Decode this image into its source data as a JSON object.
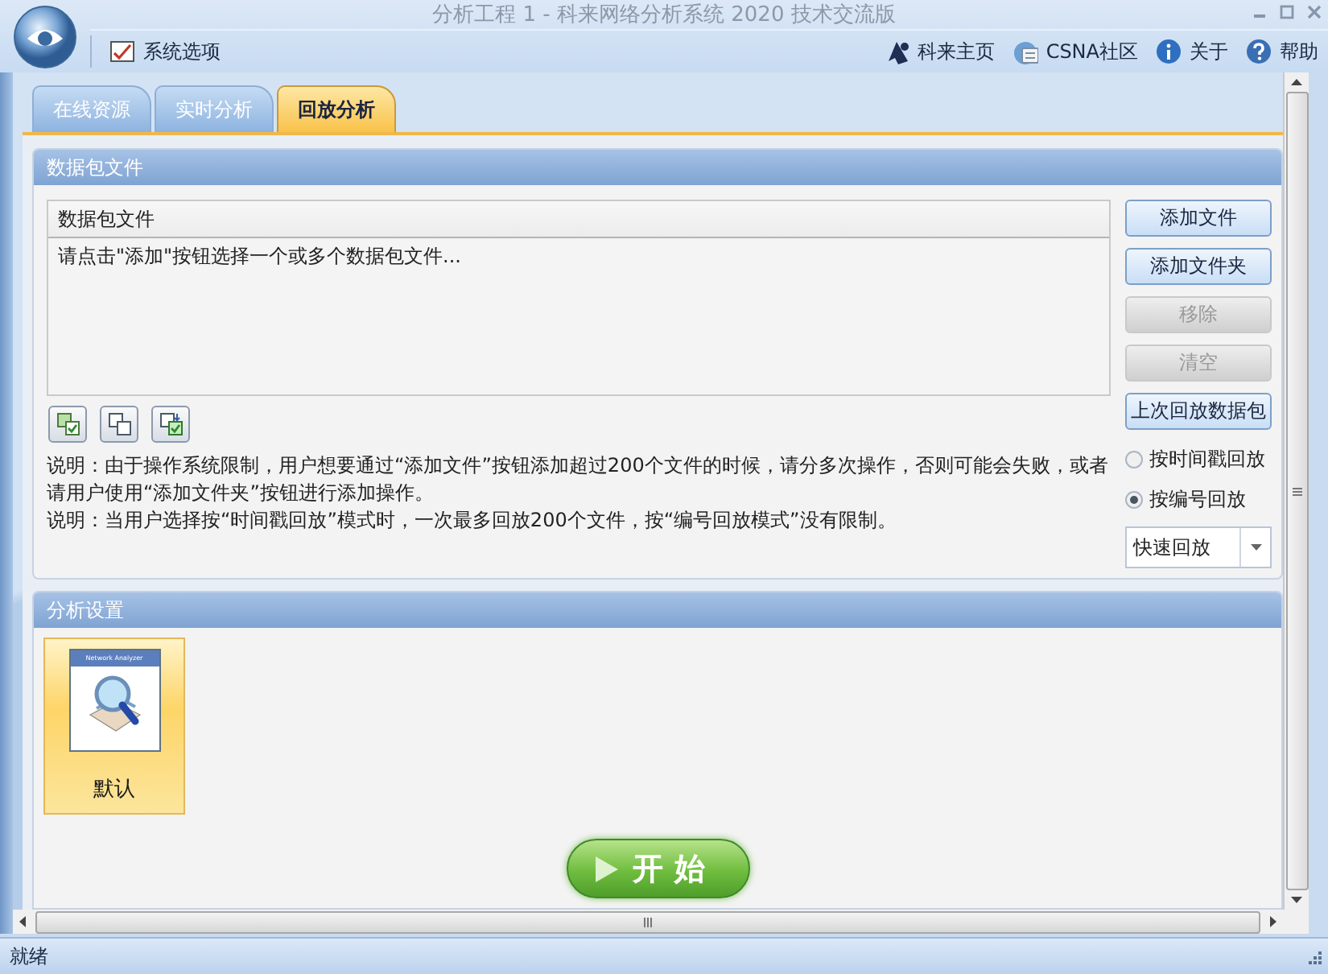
{
  "window": {
    "title": "分析工程 1 - 科来网络分析系统 2020 技术交流版"
  },
  "toolbar": {
    "options_button": "系统选项",
    "links": [
      {
        "label": "科来主页",
        "kind": "home"
      },
      {
        "label": "CSNA社区",
        "kind": "community"
      },
      {
        "label": "关于",
        "kind": "info"
      },
      {
        "label": "帮助",
        "kind": "help"
      }
    ]
  },
  "tabs": [
    {
      "label": "在线资源",
      "selected": false
    },
    {
      "label": "实时分析",
      "selected": false
    },
    {
      "label": "回放分析",
      "selected": true
    }
  ],
  "packet_panel": {
    "title": "数据包文件",
    "list": {
      "column": "数据包文件",
      "hint": "请点击\"添加\"按钮选择一个或多个数据包文件..."
    },
    "buttons": [
      {
        "label": "添加文件",
        "disabled": false
      },
      {
        "label": "添加文件夹",
        "disabled": false
      },
      {
        "label": "移除",
        "disabled": true
      },
      {
        "label": "清空",
        "disabled": true
      },
      {
        "label": "上次回放数据包",
        "disabled": false
      }
    ],
    "notes": [
      "说明：由于操作系统限制，用户想要通过“添加文件”按钮添加超过200个文件的时候，请分多次操作，否则可能会失败，或者请用户使用“添加文件夹”按钮进行添加操作。",
      "说明：当用户选择按“时间戳回放”模式时，一次最多回放200个文件，按“编号回放模式”没有限制。"
    ],
    "modes": [
      {
        "label": "按时间戳回放",
        "selected": false
      },
      {
        "label": "按编号回放",
        "selected": true
      }
    ],
    "speed": {
      "value": "快速回放"
    }
  },
  "analysis_panel": {
    "title": "分析设置",
    "profiles": [
      {
        "label": "默认",
        "thumbnail_title": "Network Analyzer",
        "selected": true
      }
    ]
  },
  "start_button": "开 始",
  "status_bar": "就绪"
}
